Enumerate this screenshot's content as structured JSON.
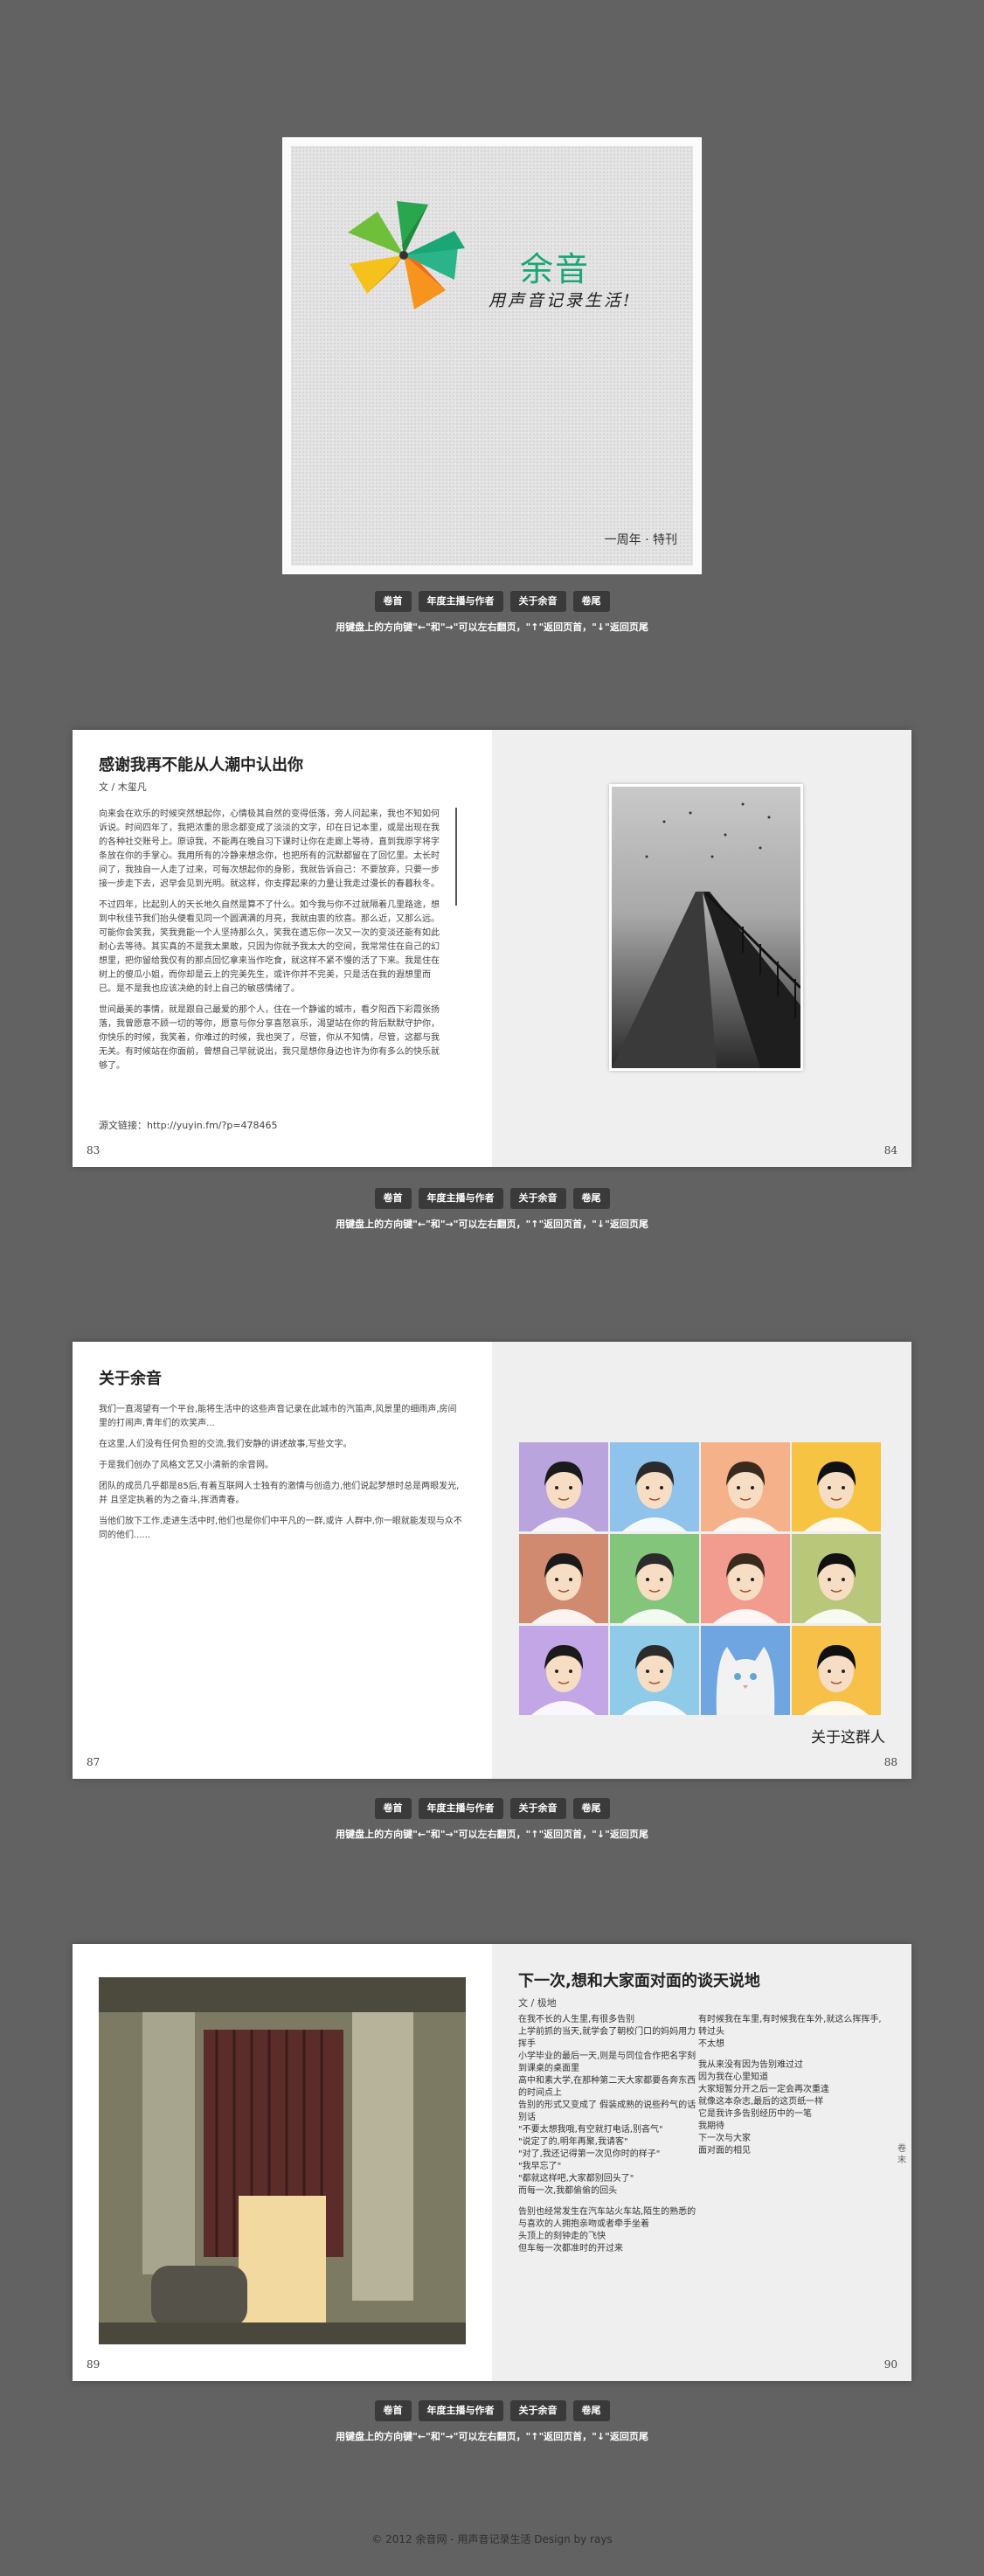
{
  "cover": {
    "brand_name": "余音",
    "slogan": "用声音记录生活!",
    "caption": "一周年 · 特刊",
    "brand_color": "#1aa675"
  },
  "nav": {
    "buttons": [
      "卷首",
      "年度主播与作者",
      "关于余音",
      "卷尾"
    ],
    "hint": "用键盘上的方向键\"←\"和\"→\"可以左右翻页，\"↑\"返回页首，\"↓\"返回页尾"
  },
  "spread1": {
    "title": "感谢我再不能从人潮中认出你",
    "author": "文 / 木玺凡",
    "paragraphs": [
      "向来会在欢乐的时候突然想起你，心情极其自然的变得低落，旁人问起来，我也不知如何诉说。时间四年了，我把浓重的思念都变成了淡淡的文字，印在日记本里，或是出现在我的各种社交账号上。原谅我，不能再在晚自习下课时让你在走廊上等待，直到我原字将字条放在你的手掌心。我用所有的冷静来想念你，也把所有的沉默都留在了回忆里。太长时间了，我独自一人走了过来，可每次想起你的身影，我就告诉自己：不要放弃，只要一步接一步走下去，迟早会见到光明。就这样，你支撑起来的力量让我走过漫长的春暮秋冬。",
      "不过四年，比起别人的天长地久自然是算不了什么。如今我与你不过就隔着几里路途，想到中秋佳节我们抬头便看见同一个圆满满的月亮，我就由衷的欣喜。那么近，又那么远。可能你会笑我，笑我竟能一个人坚持那么久，笑我在遗忘你一次又一次的变淡还能有如此耐心去等待。其实真的不是我太果敢，只因为你就予我太大的空间，我常常住在自己的幻想里，把你留给我仅有的那点回忆拿来当作吃食，就这样不紧不慢的活了下来。我是住在树上的傻瓜小姐，而你却是云上的完美先生，或许你并不完美，只是活在我的遐想里而已。是不是我也应该决绝的封上自己的敏感情绪了。",
      "世间最美的事情，就是跟自己最爱的那个人，住在一个静谧的城市，看夕阳西下彩霞张扬落，我曾愿意不顾一切的等你，愿意与你分享喜怒哀乐，渴望站在你的背后默默守护你，你快乐的时候，我笑着，你难过的时候，我也哭了，尽管，你从不知情，尽管，这都与我无关。有时候站在你面前，曾想自己早就说出，我只是想你身边也许为你有多么的快乐就够了。"
    ],
    "source": "源文链接：http://yuyin.fm/?p=478465",
    "page_left": "83",
    "page_right": "84"
  },
  "spread2": {
    "title": "关于余音",
    "paragraphs": [
      "我们一直渴望有一个平台,能将生活中的这些声音记录在此城市的汽笛声,风景里的细雨声,房间 里的打闹声,青年们的欢笑声...",
      "在这里,人们没有任何负担的交流,我们安静的讲述故事,写些文字。",
      "于是我们创办了风格文艺又小清新的余音网。",
      "团队的成员几乎都是85后,有着互联网人士独有的激情与创造力,他们说起梦想时总是两眼发光,并 且坚定执着的为之奋斗,挥洒青春。",
      "当他们放下工作,走进生活中时,他们也是你们中平凡的一群,或许 人群中,你一眼就能发现与众不同的他们......"
    ],
    "grid_caption": "关于这群人",
    "face_colors": [
      "#b9a4dd",
      "#8fc3ec",
      "#f5b28a",
      "#f6c343",
      "#d08a6f",
      "#83c67b",
      "#f19c8f",
      "#b9c77b",
      "#c3a6e6",
      "#8fcbe9",
      "#6fa6e2",
      "#f7c049"
    ],
    "page_left": "87",
    "page_right": "88"
  },
  "spread3": {
    "title": "下一次,想和大家面对面的谈天说地",
    "author": "文 / 极地",
    "poem_left": [
      "在我不长的人生里,有很多告别\n上学前抓的当天,就学会了朝校门口的妈妈用力挥手\n小学毕业的最后一天,则是与同位合作把名字刻到课桌的桌面里\n高中和素大学,在那种第二天大家都要各奔东西的时间点上\n告别的形式又变成了 假装成熟的说些矜气的话别话\n\"不要太想我哦,有空就打电话,别吝气\"\n\"说定了的,明年再聚,我请客\"\n\"对了,我还记得第一次见你时的样子\"\n\"我早忘了\"\n\"都就这样吧,大家都别回头了\"\n而每一次,我都偷偷的回头",
      "告别也经常发生在汽车站火车站,陌生的熟悉的\n与喜欢的人拥抱亲吻或者牵手坐着\n头顶上的刻钟走的飞快\n但车每一次都准时的开过来"
    ],
    "poem_right": [
      "有时候我在车里,有时候我在车外,就这么挥挥手,转过头\n不太想",
      "我从来没有因为告别难过过\n因为我在心里知道\n大家短暂分开之后一定会再次重逢\n就像这本杂志,最后的这页纸一样\n它是我许多告别经历中的一笔\n我期待\n下一次与大家\n面对面的相见"
    ],
    "side_tab": "卷末",
    "page_left": "89",
    "page_right": "90"
  },
  "footer": "© 2012 余音网 - 用声音记录生活 Design by rays"
}
